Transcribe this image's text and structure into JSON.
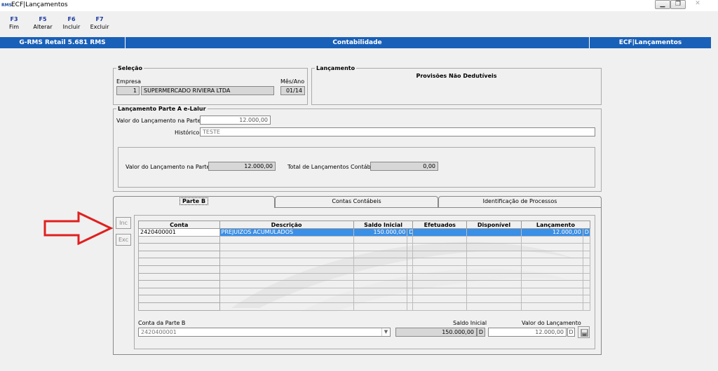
{
  "window": {
    "title": "ECF|Lançamentos",
    "app_icon": "RMS"
  },
  "fkeys": [
    {
      "key": "F3",
      "label": "Fim"
    },
    {
      "key": "F5",
      "label": "Alterar"
    },
    {
      "key": "F6",
      "label": "Incluir"
    },
    {
      "key": "F7",
      "label": "Excluir"
    }
  ],
  "header": {
    "left": "G-RMS Retail 5.681 RMS",
    "center": "Contabilidade",
    "right": "ECF|Lançamentos"
  },
  "selecao": {
    "legend": "Seleção",
    "empresa_label": "Empresa",
    "empresa_code": "1",
    "empresa_name": "SUPERMERCADO RIVIERA LTDA",
    "mesano_label": "Mês/Ano",
    "mesano_value": "01/14"
  },
  "lancamento": {
    "legend": "Lançamento",
    "title": "Provisões Não Dedutíveis"
  },
  "parteA": {
    "legend": "Lançamento Parte A e-Lalur",
    "valor_label": "Valor do Lançamento na Parte A",
    "valor": "12.000,00",
    "historico_label": "Histórico",
    "historico": "TESTE",
    "valor_b_label": "Valor do Lançamento na Parte B",
    "valor_b": "12.000,00",
    "total_label": "Total de Lançamentos Contábeis",
    "total": "0,00"
  },
  "tabs": [
    "Parte B",
    "Contas Contábeis",
    "Identificação de Processos"
  ],
  "buttons": {
    "inc": "Inc",
    "exc": "Exc"
  },
  "grid": {
    "columns": [
      "Conta",
      "Descrição",
      "Saldo Inicial",
      "Efetuados",
      "Disponível",
      "Lançamento"
    ],
    "rows": [
      {
        "conta": "2420400001",
        "descricao": "PREJUIZOS ACUMULADOS",
        "saldo": "150.000,00",
        "saldo_dc": "D",
        "efetuados": "",
        "disponivel": "",
        "lancamento": "12.000,00",
        "lanc_dc": "D"
      }
    ]
  },
  "bottom": {
    "conta_label": "Conta da Parte B",
    "conta_value": "2420400001",
    "saldo_label": "Saldo Inicial",
    "saldo_value": "150.000,00",
    "saldo_dc": "D",
    "valor_label": "Valor do Lançamento",
    "valor_value": "12.000,00",
    "valor_dc": "D"
  },
  "colors": {
    "header_blue": "#1960b8",
    "selection_blue": "#3a8fe6",
    "arrow_red": "#e0201f"
  }
}
